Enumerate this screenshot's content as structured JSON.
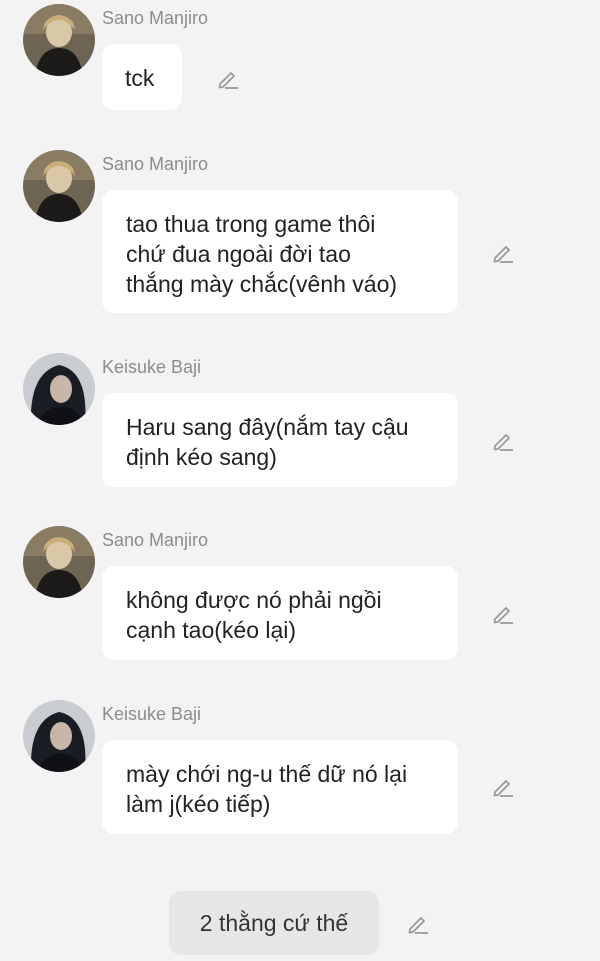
{
  "messages": [
    {
      "sender": "Sano Manjiro",
      "avatar": "sano-avatar",
      "lines": [
        "tck"
      ]
    },
    {
      "sender": "Sano Manjiro",
      "avatar": "sano-avatar",
      "lines": [
        "tao thua trong game thôi",
        "chứ đua ngoài đời tao",
        "thắng mày chắc(vênh váo)"
      ]
    },
    {
      "sender": "Keisuke Baji",
      "avatar": "baji-avatar",
      "lines": [
        "Haru sang đây(nắm tay cậu",
        "định kéo sang)"
      ]
    },
    {
      "sender": "Sano Manjiro",
      "avatar": "sano-avatar",
      "lines": [
        "không được nó phải ngồi",
        "cạnh tao(kéo lại)"
      ]
    },
    {
      "sender": "Keisuke Baji",
      "avatar": "baji-avatar",
      "lines": [
        "mày chới ng-u thế dữ nó lại",
        "làm j(kéo tiếp)"
      ]
    }
  ],
  "own_message": {
    "text": "2 thằng cứ thế"
  },
  "icons": {
    "edit": "pencil-edit-icon"
  },
  "colors": {
    "background": "#f3f3f3",
    "bubble": "#ffffff",
    "own_bubble": "#e6e6e6",
    "sender": "#8d8d8d",
    "icon": "#9a9a9a"
  }
}
